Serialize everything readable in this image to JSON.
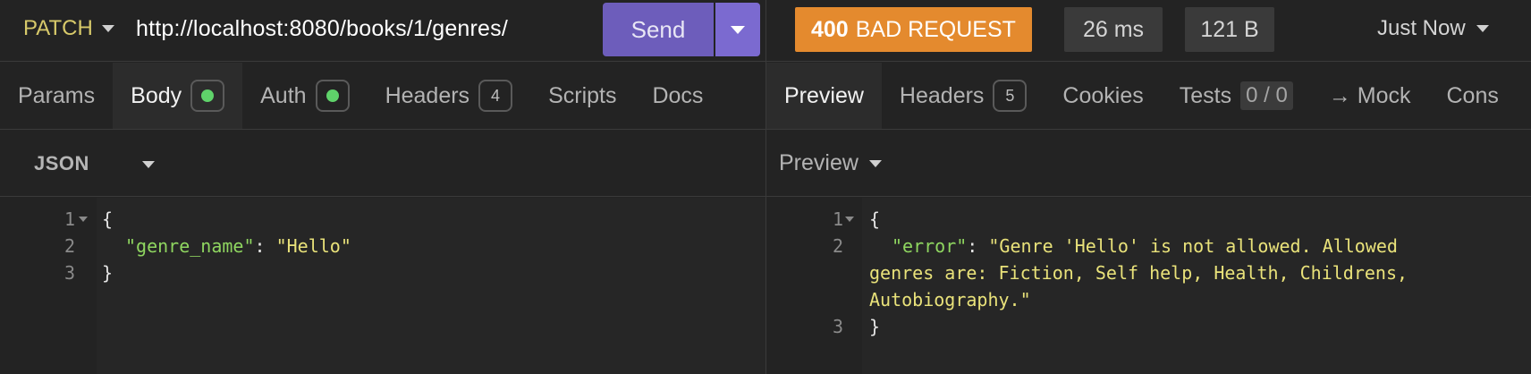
{
  "request": {
    "method": "PATCH",
    "url": "http://localhost:8080/books/1/genres/",
    "send_label": "Send",
    "tabs": [
      {
        "label": "Params"
      },
      {
        "label": "Body",
        "indicator": "dot"
      },
      {
        "label": "Auth",
        "indicator": "dot"
      },
      {
        "label": "Headers",
        "count": "4"
      },
      {
        "label": "Scripts"
      },
      {
        "label": "Docs"
      }
    ],
    "body_format": "JSON",
    "body_lines": [
      {
        "n": "1",
        "text": "{"
      },
      {
        "n": "2",
        "key": "\"genre_name\"",
        "sep": ": ",
        "value": "\"Hello\""
      },
      {
        "n": "3",
        "text": "}"
      }
    ]
  },
  "response": {
    "status_code": "400",
    "status_text": "BAD REQUEST",
    "time": "26 ms",
    "size": "121 B",
    "when": "Just Now",
    "tabs": [
      {
        "label": "Preview"
      },
      {
        "label": "Headers",
        "count": "5"
      },
      {
        "label": "Cookies"
      },
      {
        "label": "Tests",
        "count": "0 / 0"
      },
      {
        "label": "→ Mock"
      },
      {
        "label": "Cons"
      }
    ],
    "preview_mode": "Preview",
    "body_lines": [
      {
        "n": "1",
        "text": "{"
      },
      {
        "n": "2",
        "key": "\"error\"",
        "sep": ": ",
        "value": "\"Genre 'Hello' is not allowed. Allowed"
      },
      {
        "n": "",
        "value": "genres are: Fiction, Self help, Health, Childrens,"
      },
      {
        "n": "",
        "value": "Autobiography.\""
      },
      {
        "n": "3",
        "text": "}"
      }
    ]
  },
  "colors": {
    "accent_send": "#6d5dbb",
    "status_error": "#e48a2e",
    "json_key": "#8fd660",
    "json_string": "#e9e27a",
    "active_dot": "#5fd36a"
  }
}
